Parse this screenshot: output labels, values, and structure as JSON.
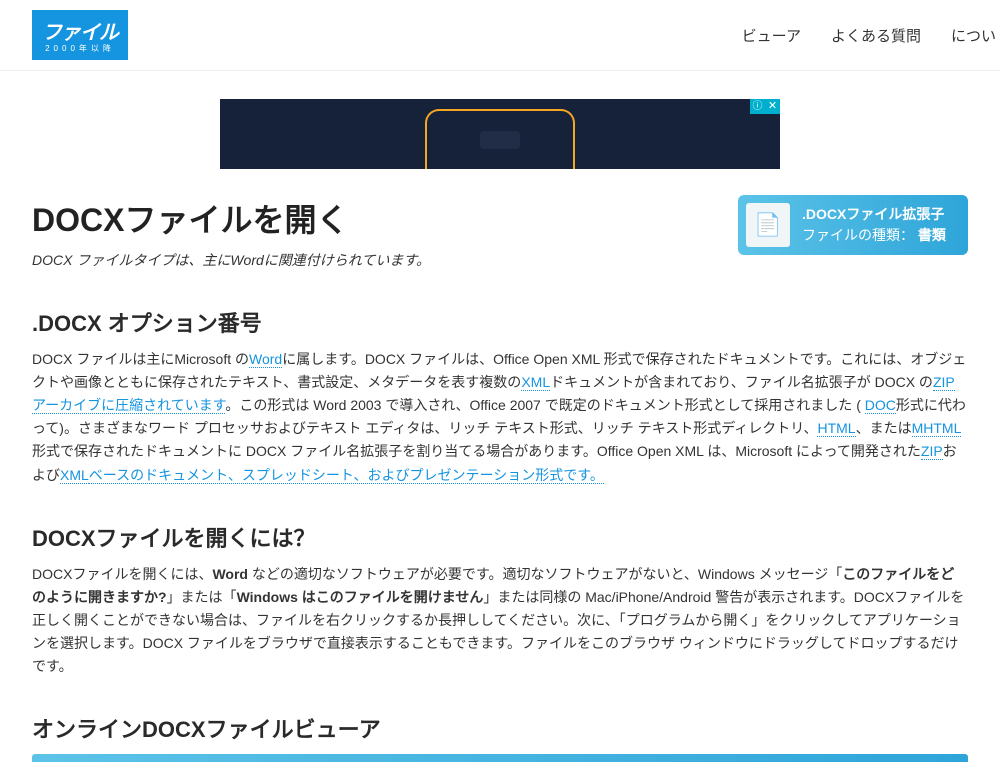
{
  "header": {
    "logo_text": "ファイル",
    "logo_sub": "2000年以降",
    "nav": [
      "ビューア",
      "よくある質問",
      "につい"
    ]
  },
  "page": {
    "title": "DOCXファイルを開く",
    "subtitle_prefix": "DOCX ファイルタイプは、主に",
    "subtitle_em": "Word",
    "subtitle_suffix": "に関連付けられています。"
  },
  "infocard": {
    "line1": ".DOCXファイル拡張子",
    "line2_label": "ファイルの種類：",
    "line2_value": "書類"
  },
  "section1": {
    "heading": ".DOCX オプション番号",
    "t1": "DOCX ファイルは主にMicrosoft の",
    "link_word": "Word",
    "t2": "に属します。DOCX ファイルは、Office Open XML 形式で保存されたドキュメントです。これには、オブジェクトや画像とともに保存されたテキスト、書式設定、メタデータを表す複数の",
    "link_xml1": "XML",
    "t3": "ドキュメントが含まれており、ファイル名拡張子が DOCX の",
    "link_zip_archive": "ZIPアーカイブに圧縮されています",
    "t4": "。この形式は Word 2003 で導入され、Office 2007 で既定のドキュメント形式として採用されました ( ",
    "link_doc": "DOC",
    "t5": "形式に代わって)。さまざまなワード プロセッサおよびテキスト エディタは、リッチ テキスト形式、リッチ テキスト形式ディレクトリ、",
    "link_html": "HTML",
    "t6": "、または",
    "link_mhtml": "MHTML",
    "t7": "形式で保存されたドキュメントに DOCX ファイル名拡張子を割り当てる場合があります。Office Open XML は、Microsoft によって開発された",
    "link_zip": "ZIP",
    "t8": "および",
    "link_xml2": "XML",
    "link_based": "ベースのドキュメント、スプレッドシート、およびプレゼンテーション形式です。"
  },
  "section2": {
    "heading": "DOCXファイルを開くには？",
    "t1": "DOCXファイルを開くには、",
    "b1": "Word",
    "t2": " などの適切なソフトウェアが必要です。適切なソフトウェアがないと、Windows メッセージ「",
    "b2": "このファイルをどのように開きますか?",
    "t3": "」または「",
    "b3": "Windows はこのファイルを開けません",
    "t4": "」または同様の Mac/iPhone/Android 警告が表示されます。DOCXファイルを正しく開くことができない場合は、ファイルを右クリックするか長押ししてください。次に、「プログラムから開く」をクリックしてアプリケーションを選択します。DOCX ファイルをブラウザで直接表示することもできます。ファイルをこのブラウザ ウィンドウにドラッグしてドロップするだけです。"
  },
  "section3": {
    "heading_pre": "オンライン",
    "heading_mid": "DOCX",
    "heading_post": "ファイルビューア"
  }
}
